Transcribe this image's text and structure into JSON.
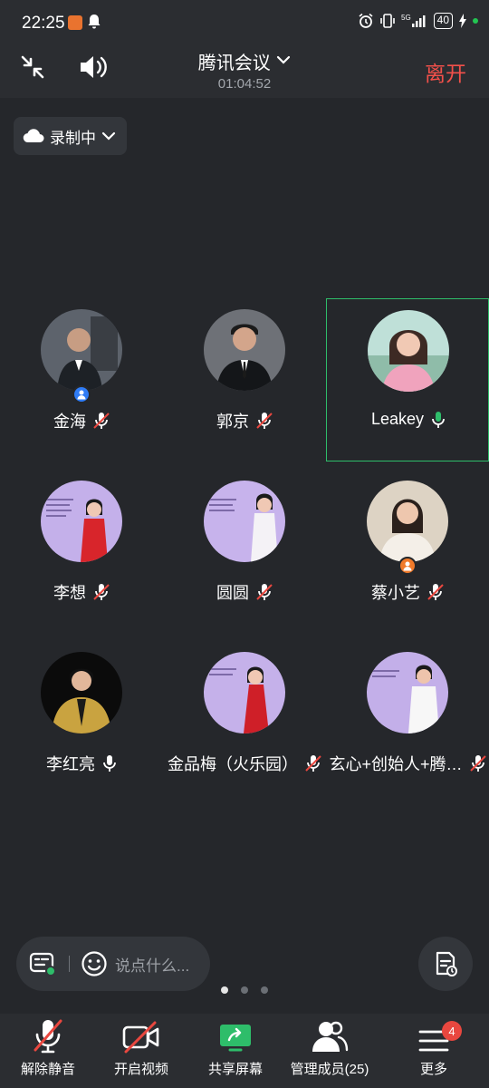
{
  "status_bar": {
    "time": "22:25",
    "battery": "40"
  },
  "header": {
    "title": "腾讯会议",
    "timer": "01:04:52",
    "leave": "离开"
  },
  "recording": {
    "label": "录制中"
  },
  "participants": [
    {
      "name": "金海",
      "mic": "muted",
      "badge": "host"
    },
    {
      "name": "郭京",
      "mic": "muted"
    },
    {
      "name": "Leakey",
      "mic": "speaking",
      "active": true
    },
    {
      "name": "李想",
      "mic": "muted"
    },
    {
      "name": "圆圆",
      "mic": "muted"
    },
    {
      "name": "蔡小艺",
      "mic": "muted",
      "badge": "cohost"
    },
    {
      "name": "李红亮",
      "mic": "on"
    },
    {
      "name": "金品梅（火乐园）",
      "mic": "muted"
    },
    {
      "name": "玄心+创始人+腾…",
      "mic": "muted"
    }
  ],
  "chat": {
    "placeholder": "说点什么..."
  },
  "toolbar": {
    "unmute": "解除静音",
    "video": "开启视频",
    "share": "共享屏幕",
    "members": "管理成员(25)",
    "more": "更多",
    "more_badge": "4"
  },
  "colors": {
    "leave": "#f2504a",
    "active_border": "#2ebd6a",
    "share": "#2ebd6a",
    "badge": "#e9473f"
  }
}
